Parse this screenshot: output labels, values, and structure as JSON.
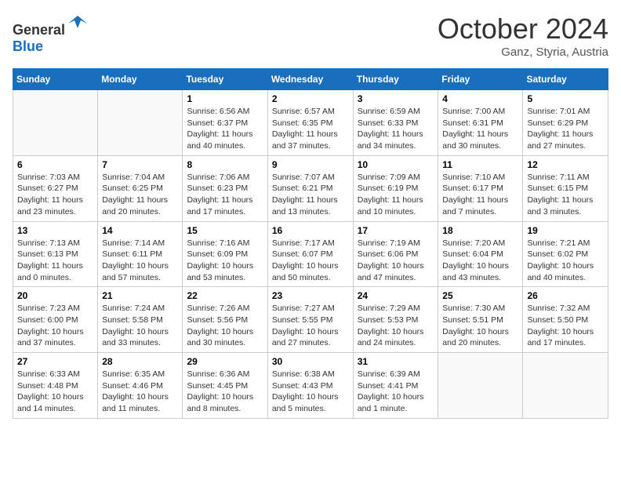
{
  "logo": {
    "general": "General",
    "blue": "Blue"
  },
  "header": {
    "month": "October 2024",
    "location": "Ganz, Styria, Austria"
  },
  "weekdays": [
    "Sunday",
    "Monday",
    "Tuesday",
    "Wednesday",
    "Thursday",
    "Friday",
    "Saturday"
  ],
  "weeks": [
    [
      {
        "day": "",
        "info": ""
      },
      {
        "day": "",
        "info": ""
      },
      {
        "day": "1",
        "info": "Sunrise: 6:56 AM\nSunset: 6:37 PM\nDaylight: 11 hours and 40 minutes."
      },
      {
        "day": "2",
        "info": "Sunrise: 6:57 AM\nSunset: 6:35 PM\nDaylight: 11 hours and 37 minutes."
      },
      {
        "day": "3",
        "info": "Sunrise: 6:59 AM\nSunset: 6:33 PM\nDaylight: 11 hours and 34 minutes."
      },
      {
        "day": "4",
        "info": "Sunrise: 7:00 AM\nSunset: 6:31 PM\nDaylight: 11 hours and 30 minutes."
      },
      {
        "day": "5",
        "info": "Sunrise: 7:01 AM\nSunset: 6:29 PM\nDaylight: 11 hours and 27 minutes."
      }
    ],
    [
      {
        "day": "6",
        "info": "Sunrise: 7:03 AM\nSunset: 6:27 PM\nDaylight: 11 hours and 23 minutes."
      },
      {
        "day": "7",
        "info": "Sunrise: 7:04 AM\nSunset: 6:25 PM\nDaylight: 11 hours and 20 minutes."
      },
      {
        "day": "8",
        "info": "Sunrise: 7:06 AM\nSunset: 6:23 PM\nDaylight: 11 hours and 17 minutes."
      },
      {
        "day": "9",
        "info": "Sunrise: 7:07 AM\nSunset: 6:21 PM\nDaylight: 11 hours and 13 minutes."
      },
      {
        "day": "10",
        "info": "Sunrise: 7:09 AM\nSunset: 6:19 PM\nDaylight: 11 hours and 10 minutes."
      },
      {
        "day": "11",
        "info": "Sunrise: 7:10 AM\nSunset: 6:17 PM\nDaylight: 11 hours and 7 minutes."
      },
      {
        "day": "12",
        "info": "Sunrise: 7:11 AM\nSunset: 6:15 PM\nDaylight: 11 hours and 3 minutes."
      }
    ],
    [
      {
        "day": "13",
        "info": "Sunrise: 7:13 AM\nSunset: 6:13 PM\nDaylight: 11 hours and 0 minutes."
      },
      {
        "day": "14",
        "info": "Sunrise: 7:14 AM\nSunset: 6:11 PM\nDaylight: 10 hours and 57 minutes."
      },
      {
        "day": "15",
        "info": "Sunrise: 7:16 AM\nSunset: 6:09 PM\nDaylight: 10 hours and 53 minutes."
      },
      {
        "day": "16",
        "info": "Sunrise: 7:17 AM\nSunset: 6:07 PM\nDaylight: 10 hours and 50 minutes."
      },
      {
        "day": "17",
        "info": "Sunrise: 7:19 AM\nSunset: 6:06 PM\nDaylight: 10 hours and 47 minutes."
      },
      {
        "day": "18",
        "info": "Sunrise: 7:20 AM\nSunset: 6:04 PM\nDaylight: 10 hours and 43 minutes."
      },
      {
        "day": "19",
        "info": "Sunrise: 7:21 AM\nSunset: 6:02 PM\nDaylight: 10 hours and 40 minutes."
      }
    ],
    [
      {
        "day": "20",
        "info": "Sunrise: 7:23 AM\nSunset: 6:00 PM\nDaylight: 10 hours and 37 minutes."
      },
      {
        "day": "21",
        "info": "Sunrise: 7:24 AM\nSunset: 5:58 PM\nDaylight: 10 hours and 33 minutes."
      },
      {
        "day": "22",
        "info": "Sunrise: 7:26 AM\nSunset: 5:56 PM\nDaylight: 10 hours and 30 minutes."
      },
      {
        "day": "23",
        "info": "Sunrise: 7:27 AM\nSunset: 5:55 PM\nDaylight: 10 hours and 27 minutes."
      },
      {
        "day": "24",
        "info": "Sunrise: 7:29 AM\nSunset: 5:53 PM\nDaylight: 10 hours and 24 minutes."
      },
      {
        "day": "25",
        "info": "Sunrise: 7:30 AM\nSunset: 5:51 PM\nDaylight: 10 hours and 20 minutes."
      },
      {
        "day": "26",
        "info": "Sunrise: 7:32 AM\nSunset: 5:50 PM\nDaylight: 10 hours and 17 minutes."
      }
    ],
    [
      {
        "day": "27",
        "info": "Sunrise: 6:33 AM\nSunset: 4:48 PM\nDaylight: 10 hours and 14 minutes."
      },
      {
        "day": "28",
        "info": "Sunrise: 6:35 AM\nSunset: 4:46 PM\nDaylight: 10 hours and 11 minutes."
      },
      {
        "day": "29",
        "info": "Sunrise: 6:36 AM\nSunset: 4:45 PM\nDaylight: 10 hours and 8 minutes."
      },
      {
        "day": "30",
        "info": "Sunrise: 6:38 AM\nSunset: 4:43 PM\nDaylight: 10 hours and 5 minutes."
      },
      {
        "day": "31",
        "info": "Sunrise: 6:39 AM\nSunset: 4:41 PM\nDaylight: 10 hours and 1 minute."
      },
      {
        "day": "",
        "info": ""
      },
      {
        "day": "",
        "info": ""
      }
    ]
  ]
}
